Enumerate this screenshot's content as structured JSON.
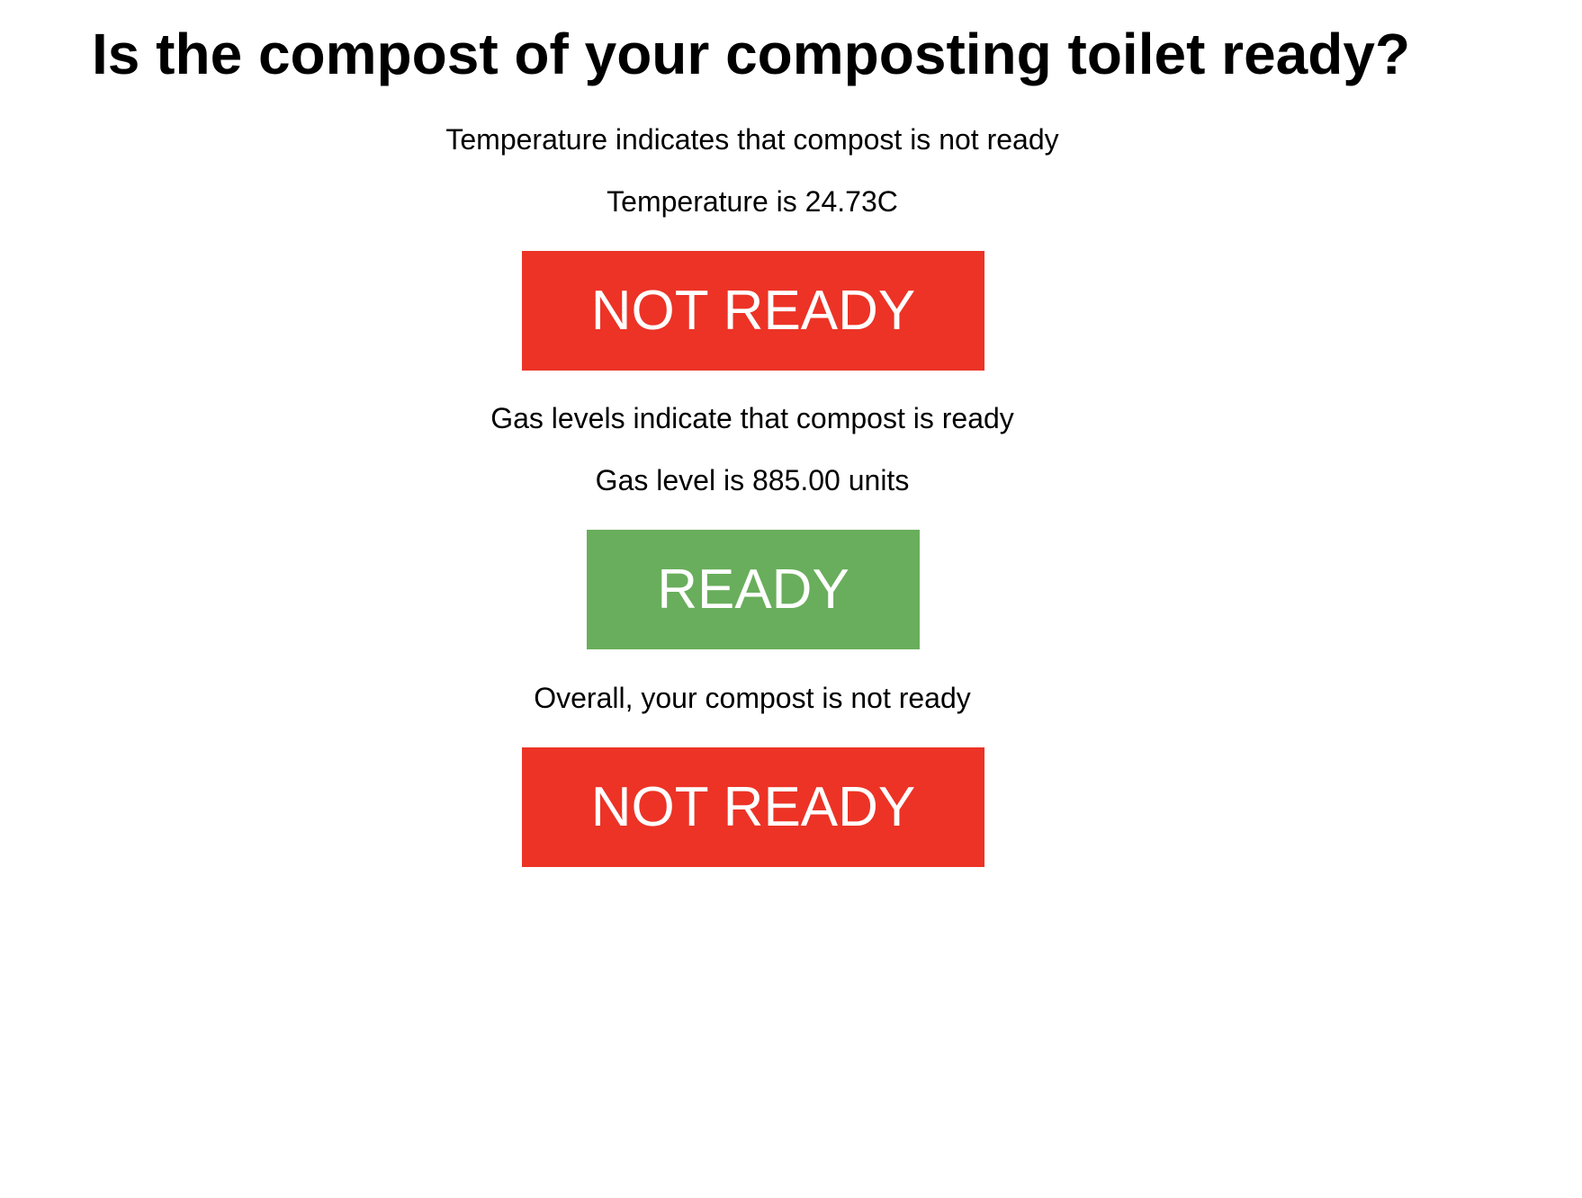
{
  "page": {
    "title": "Is the compost of your composting toilet ready?"
  },
  "temperature": {
    "indication": "Temperature indicates that compost is not ready",
    "reading": "Temperature is 24.73C",
    "status_label": "NOT READY",
    "status_color": "#ec3326"
  },
  "gas": {
    "indication": "Gas levels indicate that compost is ready",
    "reading": "Gas level is 885.00 units",
    "status_label": "READY",
    "status_color": "#69ae5c"
  },
  "overall": {
    "summary": "Overall, your compost is not ready",
    "status_label": "NOT READY",
    "status_color": "#ec3326"
  }
}
